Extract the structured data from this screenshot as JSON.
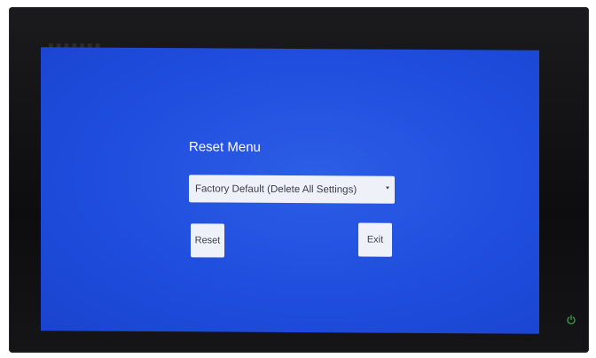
{
  "device": {
    "bezel_color": "#141416",
    "screen_color": "#2255e0",
    "power_icon": "power-icon",
    "power_led_color": "#3fa34d"
  },
  "reset_menu": {
    "title": "Reset Menu",
    "select": {
      "value": "Factory Default (Delete All Settings)",
      "icon": "chevron-down-icon"
    },
    "reset_label": "Reset",
    "exit_label": "Exit"
  }
}
